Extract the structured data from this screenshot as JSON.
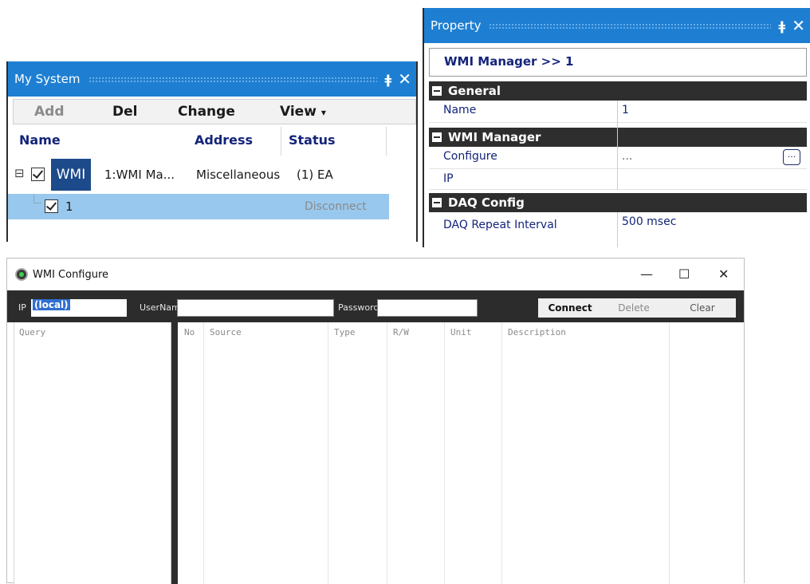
{
  "my_system": {
    "title": "My System",
    "toolbar": {
      "add": "Add",
      "del": "Del",
      "change": "Change",
      "view": "View",
      "view_arrow": "▾"
    },
    "columns": {
      "name": "Name",
      "address": "Address",
      "status": "Status"
    },
    "rows": [
      {
        "expander": "⊟",
        "badge": "WMI",
        "name": "1:WMI Ma...",
        "address": "Miscellaneous",
        "status": "(1) EA"
      },
      {
        "name": "1",
        "status": "Disconnect"
      }
    ]
  },
  "property": {
    "title": "Property",
    "header": "WMI Manager >> 1",
    "categories": {
      "general": "General",
      "wmi_manager": "WMI Manager",
      "daq_config": "DAQ Config"
    },
    "rows": {
      "name": {
        "key": "Name",
        "value": "1"
      },
      "configure": {
        "key": "Configure",
        "value": "...",
        "button": "..."
      },
      "ip": {
        "key": "IP",
        "value": ""
      },
      "daq_repeat": {
        "key": "DAQ Repeat Interval",
        "value": "500 msec"
      }
    }
  },
  "wmi_configure": {
    "title": "WMI Configure",
    "controls": {
      "minimize": "—",
      "maximize": "☐",
      "close": "✕"
    },
    "ip_label": "IP",
    "ip_value": "(local)",
    "username_label": "UserName",
    "username_value": "",
    "password_label": "Password",
    "password_value": "",
    "buttons": {
      "connect": "Connect",
      "delete": "Delete",
      "clear": "Clear"
    },
    "query_header": "Query",
    "grid_columns": [
      "No",
      "Source",
      "Type",
      "R/W",
      "Unit",
      "Description"
    ]
  },
  "colors": {
    "title_bar_blue": "#1e7fd2",
    "selection_blue": "#99c8ee",
    "category_dark": "#2e2e2e",
    "label_navy": "#14247a"
  }
}
